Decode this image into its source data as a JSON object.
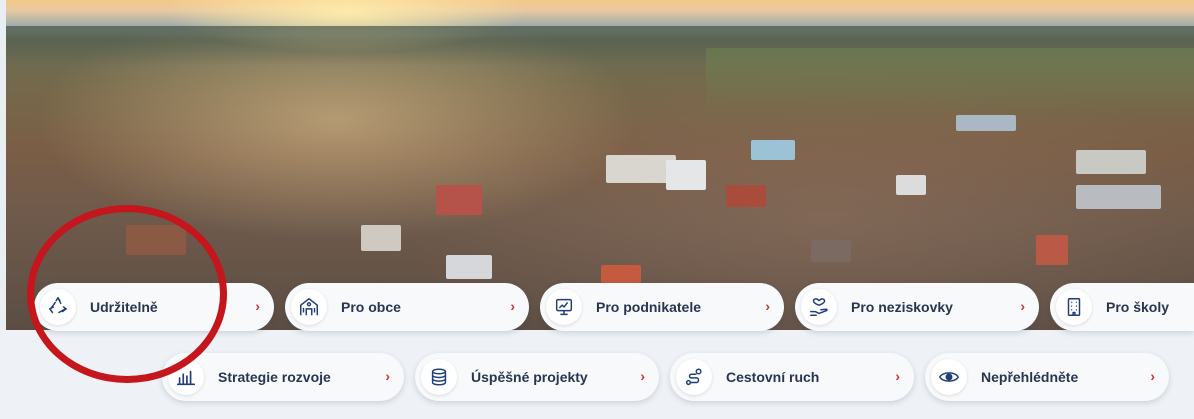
{
  "categories_row1": [
    {
      "label": "Udržitelně",
      "icon": "recycle-icon"
    },
    {
      "label": "Pro obce",
      "icon": "town-hall-icon"
    },
    {
      "label": "Pro podnikatele",
      "icon": "business-chart-icon"
    },
    {
      "label": "Pro neziskovky",
      "icon": "heart-hand-icon"
    },
    {
      "label": "Pro školy",
      "icon": "school-building-icon"
    }
  ],
  "categories_row2": [
    {
      "label": "Strategie rozvoje",
      "icon": "bar-chart-icon"
    },
    {
      "label": "Úspěšné projekty",
      "icon": "coins-stack-icon"
    },
    {
      "label": "Cestovní ruch",
      "icon": "route-icon"
    },
    {
      "label": "Nepřehlédněte",
      "icon": "eye-icon"
    }
  ],
  "chevron": "›",
  "colors": {
    "accent": "#c0353a",
    "highlight_circle": "#c4161c",
    "label": "#2a3550",
    "icon": "#1f3f7a"
  }
}
